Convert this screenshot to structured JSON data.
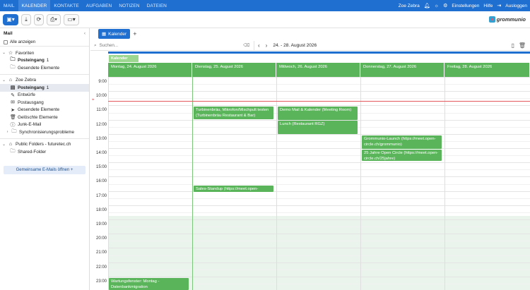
{
  "nav": {
    "items": [
      "MAIL",
      "KALENDER",
      "KONTAKTE",
      "AUFGABEN",
      "NOTIZEN",
      "DATEIEN"
    ],
    "active": "KALENDER",
    "user": "Zoe Zebra",
    "settings": "Einstellungen",
    "help": "Hilfe",
    "logout": "Ausloggen"
  },
  "logo": "grommunio",
  "sidebar": {
    "title": "Mail",
    "show_all": "Alle anzeigen",
    "favorites_label": "Favoriten",
    "fav_inbox": "Posteingang",
    "fav_inbox_count": "1",
    "fav_sent": "Gesendete Elemente",
    "account": "Zoe Zebra",
    "inbox": "Posteingang",
    "inbox_count": "1",
    "drafts": "Entwürfe",
    "outbox": "Postausgang",
    "sent": "Gesendete Elemente",
    "deleted": "Gelöschte Elemente",
    "junk": "Junk-E-Mail",
    "sync": "Synchronisierungsprobleme",
    "public": "Public Folders - futuretec.ch",
    "shared": "Shared-Folder",
    "open_shared": "Gemeinsame E-Mails öffnen +"
  },
  "tabs": {
    "calendar": "Kalender",
    "add": "+"
  },
  "search": {
    "placeholder": "Suchen..."
  },
  "range": "24. - 28. August 2026",
  "calendar": {
    "chip": "Kalender",
    "days": [
      "Montag, 24. August 2026",
      "Dienstag, 25. August 2026",
      "Mittwoch, 26. August 2026",
      "Donnerstag, 27. August 2026",
      "Freitag, 28. August 2026"
    ],
    "hours": [
      "9:00",
      "10:00",
      "11:00",
      "12:00",
      "13:00",
      "14:00",
      "15:00",
      "16:00",
      "17:00",
      "18:00",
      "19:00",
      "20:00",
      "21:00",
      "22:00",
      "23:00"
    ],
    "events": [
      {
        "text": "Turbinenbräu, Mikrofon/Mischpult testen (Turbinenbräu Restaurant & Bar)"
      },
      {
        "text": "Demo Mail & Kalender (Meeting Room)"
      },
      {
        "text": "Lunch (Restaurant RGZ)"
      },
      {
        "text": "Grommunio-Launch (https://meet.open-circle.ch/grommunio)"
      },
      {
        "text": "25 Jahre Open Circle (https://meet.open-circle.ch/25jahre)"
      },
      {
        "text": "Sales-Standup (https://meet.open-"
      },
      {
        "text": "Wartungsfenster: Montag - Datenbankmigration"
      }
    ]
  }
}
